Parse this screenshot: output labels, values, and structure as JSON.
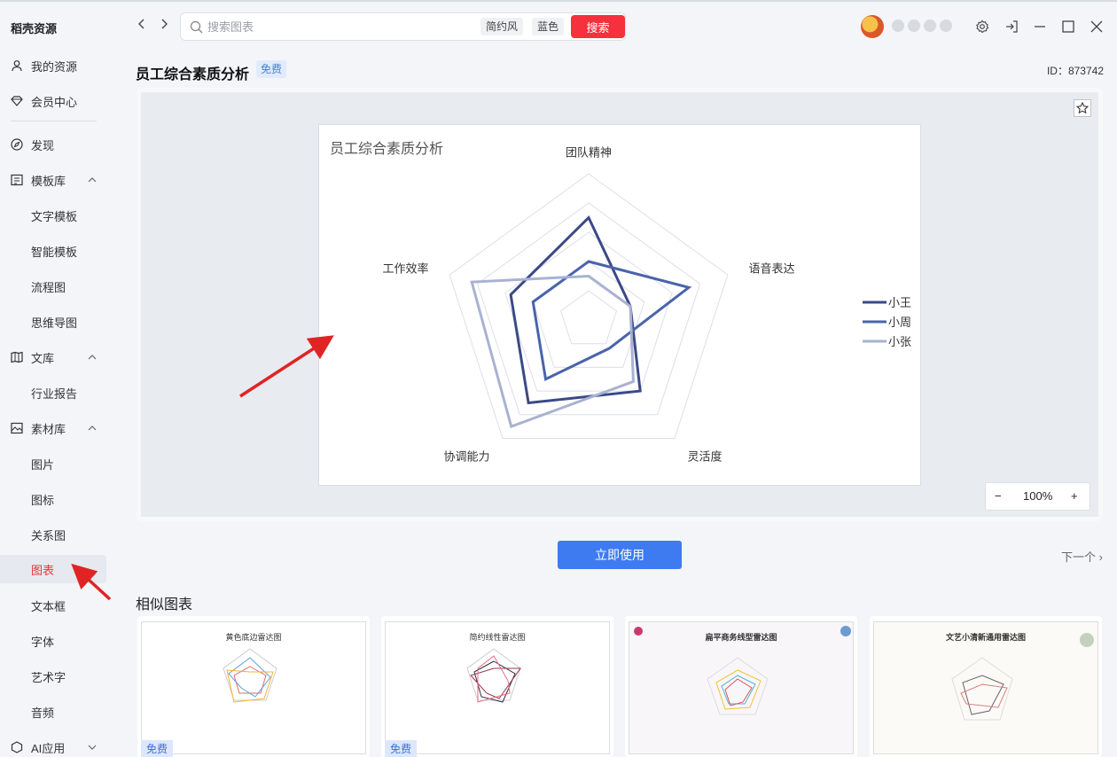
{
  "app": {
    "brand": "稻壳资源"
  },
  "sidebar": {
    "items": [
      {
        "label": "我的资源"
      },
      {
        "label": "会员中心"
      },
      {
        "label": "发现"
      },
      {
        "label": "模板库"
      },
      {
        "label": "文字模板"
      },
      {
        "label": "智能模板"
      },
      {
        "label": "流程图"
      },
      {
        "label": "思维导图"
      },
      {
        "label": "文库"
      },
      {
        "label": "行业报告"
      },
      {
        "label": "素材库"
      },
      {
        "label": "图片"
      },
      {
        "label": "图标"
      },
      {
        "label": "关系图"
      },
      {
        "label": "图表"
      },
      {
        "label": "文本框"
      },
      {
        "label": "字体"
      },
      {
        "label": "艺术字"
      },
      {
        "label": "音频"
      },
      {
        "label": "AI应用"
      }
    ]
  },
  "search": {
    "placeholder": "搜索图表",
    "tags": [
      "简约风",
      "蓝色"
    ],
    "button": "搜索"
  },
  "detail": {
    "title": "员工综合素质分析",
    "badge": "免费",
    "id": "ID：873742",
    "zoom": "100%",
    "use_button": "立即使用",
    "next_link": "下一个"
  },
  "similar": {
    "heading": "相似图表",
    "cards": [
      {
        "title": "黄色底边雷达图",
        "badge": "免费"
      },
      {
        "title": "简约线性雷达图",
        "badge": "免费"
      },
      {
        "title": "扁平商务线型雷达图",
        "badge": ""
      },
      {
        "title": "文艺小清新通用雷达图",
        "badge": ""
      }
    ]
  },
  "chart_data": {
    "type": "radar",
    "title": "员工综合素质分析",
    "axes": [
      "团队精神",
      "语音表达",
      "灵活度",
      "协调能力",
      "工作效率"
    ],
    "range": [
      0,
      5
    ],
    "legend_position": "right",
    "series": [
      {
        "name": "小王",
        "color": "#3b4a86",
        "values": [
          3.5,
          1.5,
          3.0,
          3.5,
          2.8
        ]
      },
      {
        "name": "小周",
        "color": "#4a64aa",
        "values": [
          2.0,
          3.6,
          1.2,
          2.5,
          2.0
        ]
      },
      {
        "name": "小张",
        "color": "#a9b2d2",
        "values": [
          1.5,
          1.5,
          2.6,
          4.5,
          4.2
        ]
      }
    ]
  }
}
